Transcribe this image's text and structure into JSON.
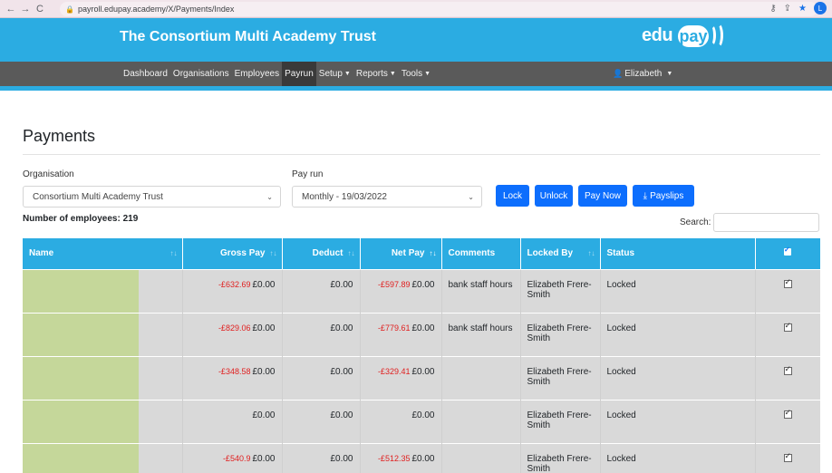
{
  "browser": {
    "url": "payroll.edupay.academy/X/Payments/Index",
    "profile_initial": "L"
  },
  "header": {
    "trust_name": "The Consortium Multi Academy Trust",
    "logo_left": "edu",
    "logo_pill": "pay",
    "brand_color": "#2bace2"
  },
  "menu": {
    "items": [
      {
        "label": "Dashboard",
        "dropdown": false
      },
      {
        "label": "Organisations",
        "dropdown": false
      },
      {
        "label": "Employees",
        "dropdown": false
      },
      {
        "label": "Payrun",
        "dropdown": false,
        "active": true
      },
      {
        "label": "Setup",
        "dropdown": true
      },
      {
        "label": "Reports",
        "dropdown": true
      },
      {
        "label": "Tools",
        "dropdown": true
      }
    ],
    "user": "Elizabeth"
  },
  "page": {
    "title": "Payments",
    "organisation_label": "Organisation",
    "organisation_value": "Consortium Multi Academy Trust",
    "payrun_label": "Pay run",
    "payrun_value": "Monthly - 19/03/2022",
    "buttons": {
      "lock": "Lock",
      "unlock": "Unlock",
      "pay_now": "Pay Now",
      "payslips": "Payslips"
    },
    "employee_count": "Number of employees: 219",
    "search_label": "Search:"
  },
  "table": {
    "columns": [
      "Name",
      "Gross Pay",
      "Deduct",
      "Net Pay",
      "Comments",
      "Locked By",
      "Status"
    ],
    "rows": [
      {
        "gross_old": "-£632.69",
        "gross": "£0.00",
        "deduct": "£0.00",
        "net_old": "-£597.89",
        "net": "£0.00",
        "comments": "bank staff hours",
        "locked_by": "Elizabeth Frere-Smith",
        "status": "Locked"
      },
      {
        "gross_old": "-£829.06",
        "gross": "£0.00",
        "deduct": "£0.00",
        "net_old": "-£779.61",
        "net": "£0.00",
        "comments": "bank staff hours",
        "locked_by": "Elizabeth Frere-Smith",
        "status": "Locked"
      },
      {
        "gross_old": "-£348.58",
        "gross": "£0.00",
        "deduct": "£0.00",
        "net_old": "-£329.41",
        "net": "£0.00",
        "comments": "",
        "locked_by": "Elizabeth Frere-Smith",
        "status": "Locked"
      },
      {
        "gross_old": "",
        "gross": "£0.00",
        "deduct": "£0.00",
        "net_old": "",
        "net": "£0.00",
        "comments": "",
        "locked_by": "Elizabeth Frere-Smith",
        "status": "Locked"
      },
      {
        "gross_old": "-£540.9",
        "gross": "£0.00",
        "deduct": "£0.00",
        "net_old": "-£512.35",
        "net": "£0.00",
        "comments": "",
        "locked_by": "Elizabeth Frere-Smith",
        "status": "Locked"
      }
    ]
  }
}
